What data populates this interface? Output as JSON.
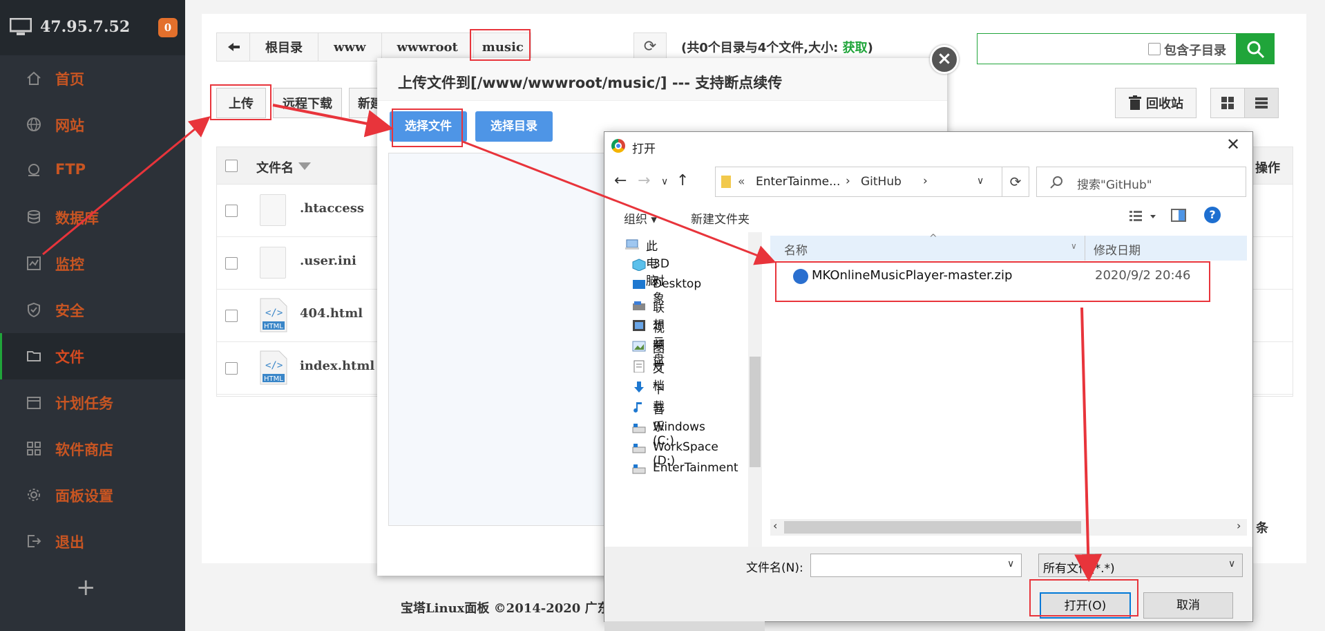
{
  "sidebar": {
    "host_ip": "47.95.7.52",
    "notification_count": "0",
    "items": [
      {
        "label": "首页",
        "icon": "home-icon"
      },
      {
        "label": "网站",
        "icon": "globe-icon"
      },
      {
        "label": "FTP",
        "icon": "ftp-icon"
      },
      {
        "label": "数据库",
        "icon": "database-icon"
      },
      {
        "label": "监控",
        "icon": "monitor-icon"
      },
      {
        "label": "安全",
        "icon": "shield-icon"
      },
      {
        "label": "文件",
        "icon": "folder-icon"
      },
      {
        "label": "计划任务",
        "icon": "calendar-icon"
      },
      {
        "label": "软件商店",
        "icon": "apps-icon"
      },
      {
        "label": "面板设置",
        "icon": "gear-icon"
      },
      {
        "label": "退出",
        "icon": "logout-icon"
      }
    ],
    "active_item": "文件",
    "add_symbol": "+"
  },
  "file_manager": {
    "breadcrumb": [
      "根目录",
      "www",
      "wwwroot",
      "music"
    ],
    "summary_prefix": "(共0个目录与4个文件,大小: ",
    "summary_link": "获取",
    "summary_suffix": ")",
    "include_subdir_label": "包含子目录",
    "toolbar": {
      "upload": "上传",
      "remote_download": "远程下载",
      "new_partial": "新建"
    },
    "recycle_bin": "回收站",
    "columns": {
      "name": "文件名",
      "actions": "操作"
    },
    "files": [
      {
        "name": ".htaccess",
        "type": "file"
      },
      {
        "name": ".user.ini",
        "type": "file"
      },
      {
        "name": "404.html",
        "type": "html"
      },
      {
        "name": "index.html",
        "type": "html"
      }
    ],
    "html_tag": "HTML",
    "pager_unit": "条",
    "footer": "宝塔Linux面板 ©2014-2020 广东"
  },
  "upload_dialog": {
    "title": "上传文件到[/www/wwwroot/music/] --- 支持断点续传",
    "select_file": "选择文件",
    "select_dir": "选择目录"
  },
  "open_dialog": {
    "title": "打开",
    "path_prefix": "«",
    "path": [
      "EnterTainme...",
      "GitHub"
    ],
    "search_placeholder": "搜索\"GitHub\"",
    "organize": "组织 ▾",
    "new_folder": "新建文件夹",
    "tree": [
      {
        "label": "此电脑",
        "icon": "computer-icon"
      },
      {
        "label": "3D 对象",
        "icon": "cube-icon"
      },
      {
        "label": "Desktop",
        "icon": "desktop-icon"
      },
      {
        "label": "联想云盘",
        "icon": "cloud-drive-icon"
      },
      {
        "label": "视频",
        "icon": "video-icon"
      },
      {
        "label": "图片",
        "icon": "picture-icon"
      },
      {
        "label": "文档",
        "icon": "document-icon"
      },
      {
        "label": "下载",
        "icon": "download-icon"
      },
      {
        "label": "音乐",
        "icon": "music-icon"
      },
      {
        "label": "Windows (C:)",
        "icon": "drive-icon"
      },
      {
        "label": "WorkSpace (D:)",
        "icon": "drive-icon"
      },
      {
        "label": "EnterTainment",
        "icon": "drive-icon"
      }
    ],
    "columns": {
      "name": "名称",
      "modified": "修改日期"
    },
    "files": [
      {
        "name": "MKOnlineMusicPlayer-master.zip",
        "modified": "2020/9/2 20:46"
      }
    ],
    "filename_label": "文件名(N):",
    "filename_value": "",
    "filetype": "所有文件(*.*)",
    "open_button": "打开(O)",
    "cancel_button": "取消"
  },
  "colors": {
    "accent_green": "#20a53a",
    "annotation_red": "#e8343b",
    "nav_text": "#c85522",
    "upload_blue": "#4e95e6"
  }
}
